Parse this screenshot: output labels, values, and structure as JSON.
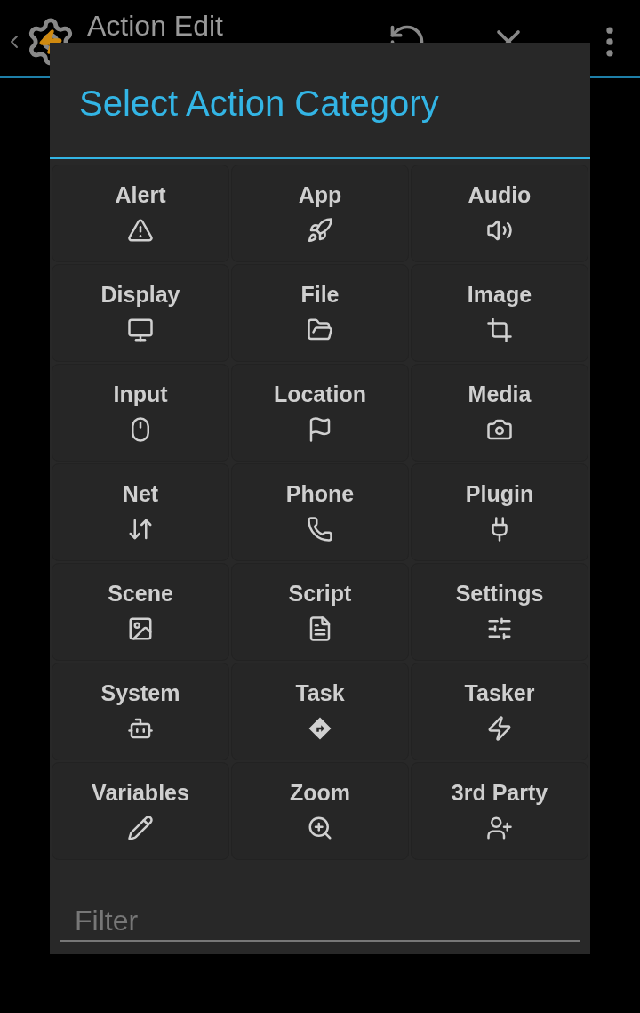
{
  "action_bar": {
    "title": "Action Edit"
  },
  "dialog": {
    "title": "Select Action Category",
    "categories": [
      {
        "label": "Alert"
      },
      {
        "label": "App"
      },
      {
        "label": "Audio"
      },
      {
        "label": "Display"
      },
      {
        "label": "File"
      },
      {
        "label": "Image"
      },
      {
        "label": "Input"
      },
      {
        "label": "Location"
      },
      {
        "label": "Media"
      },
      {
        "label": "Net"
      },
      {
        "label": "Phone"
      },
      {
        "label": "Plugin"
      },
      {
        "label": "Scene"
      },
      {
        "label": "Script"
      },
      {
        "label": "Settings"
      },
      {
        "label": "System"
      },
      {
        "label": "Task"
      },
      {
        "label": "Tasker"
      },
      {
        "label": "Variables"
      },
      {
        "label": "Zoom"
      },
      {
        "label": "3rd Party"
      }
    ],
    "filter": {
      "placeholder": "Filter"
    }
  }
}
